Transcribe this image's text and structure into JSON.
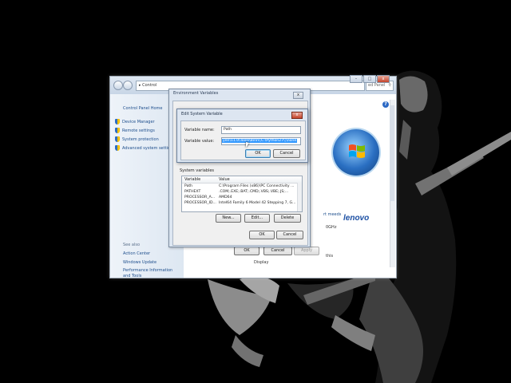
{
  "control_panel": {
    "address_text": "Control",
    "search_placeholder": "ed Panel",
    "left_pane": {
      "home_link": "Control Panel Home",
      "tasks": [
        {
          "label": "Device Manager"
        },
        {
          "label": "Remote settings"
        },
        {
          "label": "System protection"
        },
        {
          "label": "Advanced system settings"
        }
      ],
      "see_also_heading": "See also",
      "see_also": [
        {
          "label": "Action Center"
        },
        {
          "label": "Windows Update"
        },
        {
          "label": "Performance Information and Tools"
        }
      ]
    },
    "main": {
      "ghz_text": "0GHz",
      "truncated_link": "rt meeds",
      "brand_logo": "lenovo",
      "this_text": "this",
      "display_text": "Display"
    },
    "window_buttons": [
      "–",
      "□",
      "x"
    ]
  },
  "env_dialog": {
    "title": "Environment Variables",
    "close_label": "x",
    "system_variables_label": "System variables",
    "columns": [
      "Variable",
      "Value"
    ],
    "rows": [
      {
        "variable": "Path",
        "value": "C:\\Program Files (x86)\\PC Connectivity ..."
      },
      {
        "variable": "PATHEXT",
        "value": ".COM;.EXE;.BAT;.CMD;.VBS;.VBE;.JS;..."
      },
      {
        "variable": "PROCESSOR_A...",
        "value": "AMD64"
      },
      {
        "variable": "PROCESSOR_ID...",
        "value": "Intel64 Family 6 Model 42 Stepping 7, G..."
      }
    ],
    "buttons": {
      "new": "New...",
      "edit": "Edit...",
      "delete": "Delete"
    },
    "ok": "OK",
    "cancel": "Cancel"
  },
  "behind_dialog": {
    "ok": "OK",
    "cancel": "Cancel",
    "apply": "Apply"
  },
  "edit_dialog": {
    "title": "Edit System Variable",
    "close_label": "x",
    "name_label": "Variable name:",
    "name_value": "Path",
    "value_label": "Variable value:",
    "value_value": "yen\\11.0\\Tools\\Binn\\;C:\\Python27\\;\\none",
    "ok": "OK",
    "cancel": "Cancel"
  }
}
